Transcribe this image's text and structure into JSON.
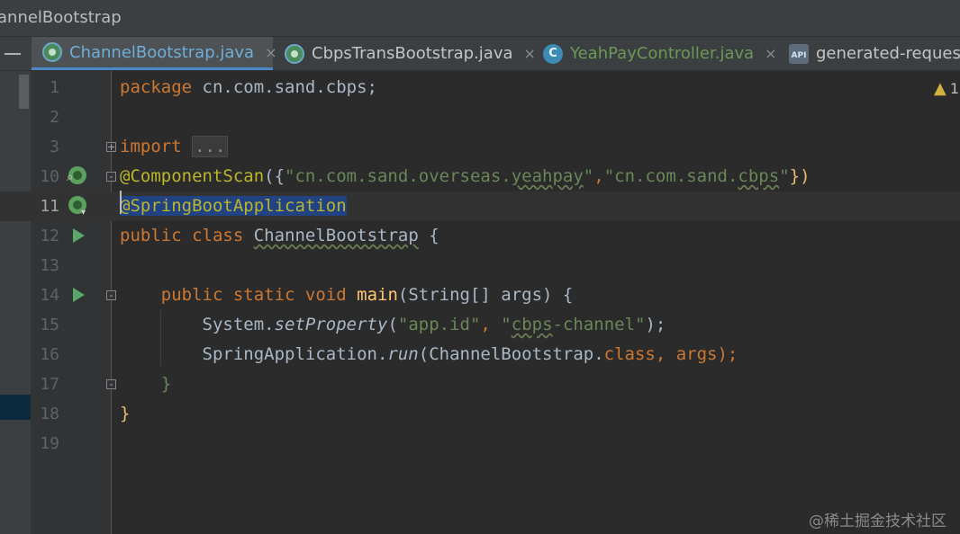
{
  "breadcrumb": "annelBootstrap",
  "tabs": [
    {
      "label": "ChannelBootstrap.java",
      "icon": "spring-boot-class-icon",
      "close": "×",
      "state": "active"
    },
    {
      "label": "CbpsTransBootstrap.java",
      "icon": "spring-boot-class-icon",
      "close": "×",
      "state": "normal"
    },
    {
      "label": "YeahPayController.java",
      "icon": "java-class-icon",
      "icon_text": "C",
      "close": "×",
      "state": "modified"
    },
    {
      "label": "generated-request",
      "icon": "api-icon",
      "icon_text": "API",
      "state": "normal"
    }
  ],
  "warnings": {
    "icon": "warning-icon",
    "symbol": "▲",
    "count": "1"
  },
  "line_numbers": [
    "1",
    "2",
    "3",
    "10",
    "11",
    "12",
    "13",
    "14",
    "15",
    "16",
    "17",
    "18",
    "19"
  ],
  "code": {
    "l1_kw": "package",
    "l1_rest": " cn.com.sand.cbps;",
    "l3_kw": "import",
    "l3_fold": "...",
    "l10_ann": "@ComponentScan",
    "l10_open": "({",
    "l10_s1a": "\"cn.com.sand.overseas.",
    "l10_s1b": "yeahpay",
    "l10_s1c": "\"",
    "l10_comma": ",",
    "l10_s2a": "\"cn.com.sand.",
    "l10_s2b": "cbps",
    "l10_s2c": "\"",
    "l10_close": "})",
    "l11_ann": "@SpringBootApplication",
    "l12_kw": "public class",
    "l12_sp": " ",
    "l12_name": "ChannelBootstrap",
    "l12_brace": " {",
    "l14_indent": "    ",
    "l14_kw": "public static void",
    "l14_sp": " ",
    "l14_name": "main",
    "l14_rest": "(String[] args) {",
    "l15_indent": "        ",
    "l15_obj": "System.",
    "l15_m": "setProperty",
    "l15_p1": "(",
    "l15_s1": "\"app.id\"",
    "l15_c": ", ",
    "l15_s2a": "\"",
    "l15_s2b": "cbps",
    "l15_s2c": "-channel\"",
    "l15_end": ");",
    "l16_indent": "        ",
    "l16_obj": "SpringApplication.",
    "l16_m": "run",
    "l16_p1": "(ChannelBootstrap.",
    "l16_kw": "class",
    "l16_end": ", args);",
    "l17_indent": "    ",
    "l17_brace": "}",
    "l18_brace": "}"
  },
  "watermark": "@稀土掘金技术社区"
}
